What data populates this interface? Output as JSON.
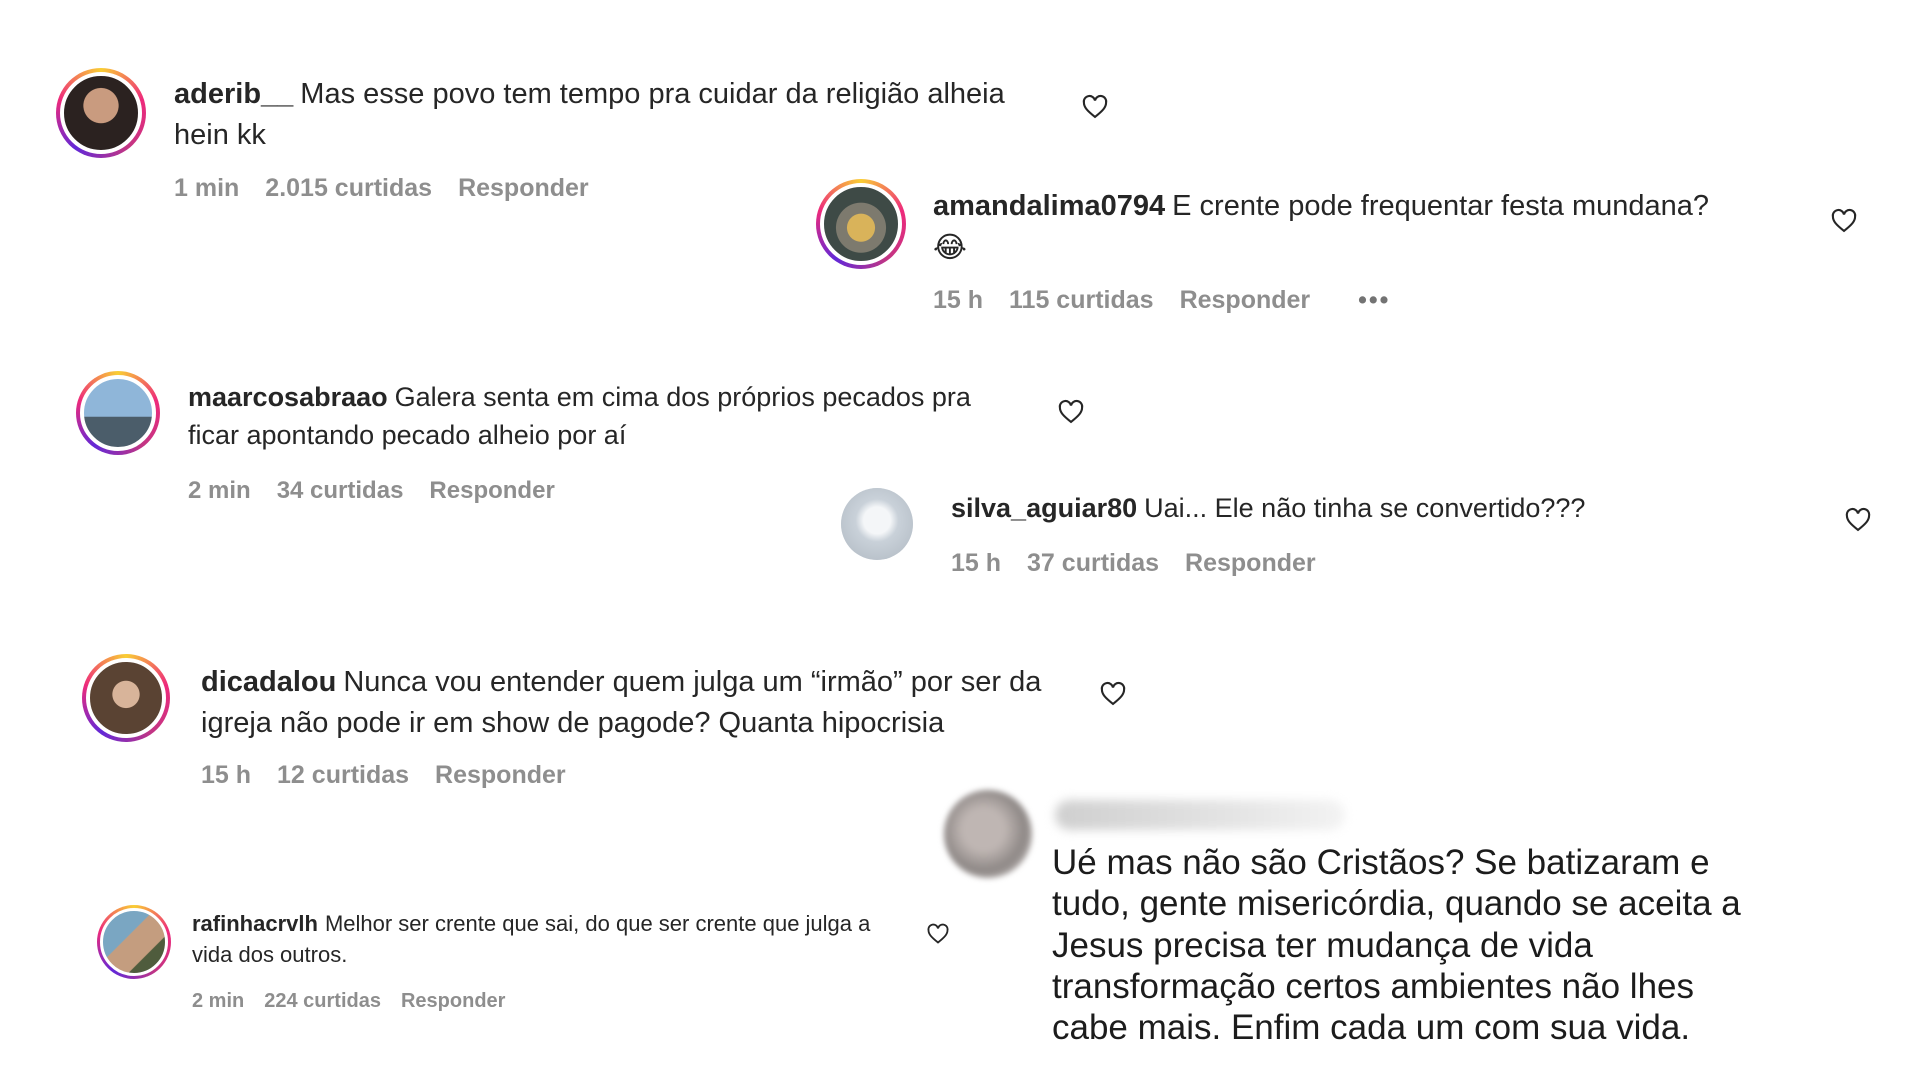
{
  "comments": [
    {
      "user": "aderib__",
      "text": "Mas esse povo tem tempo pra cuidar da religião alheia hein kk",
      "time": "1 min",
      "likes": "2.015 curtidas",
      "reply": "Responder"
    },
    {
      "user": "amandalima0794",
      "text": "E crente pode frequentar festa mundana?",
      "emoji": "😂",
      "time": "15 h",
      "likes": "115 curtidas",
      "reply": "Responder",
      "more": "•••"
    },
    {
      "user": "maarcosabraao",
      "text": "Galera senta em cima dos próprios pecados pra ficar apontando pecado alheio por aí",
      "time": "2 min",
      "likes": "34 curtidas",
      "reply": "Responder"
    },
    {
      "user": "silva_aguiar80",
      "text": "Uai... Ele não tinha se convertido???",
      "time": "15 h",
      "likes": "37 curtidas",
      "reply": "Responder"
    },
    {
      "user": "dicadalou",
      "text": "Nunca vou entender quem julga um “irmão” por ser da igreja não pode ir em show de pagode? Quanta hipocrisia",
      "time": "15 h",
      "likes": "12 curtidas",
      "reply": "Responder"
    },
    {
      "user": "rafinhacrvlh",
      "text": "Melhor ser crente que sai, do que ser crente que julga a vida dos outros.",
      "time": "2 min",
      "likes": "224 curtidas",
      "reply": "Responder"
    },
    {
      "text": "Ué mas não são Cristãos? Se batizaram e tudo, gente misericórdia, quando se aceita a Jesus precisa ter mudança de vida transformação certos ambientes não lhes cabe mais. Enfim cada um com sua vida."
    }
  ],
  "icons": {
    "like": "heart-outline-icon",
    "more": "more-dots-icon"
  }
}
